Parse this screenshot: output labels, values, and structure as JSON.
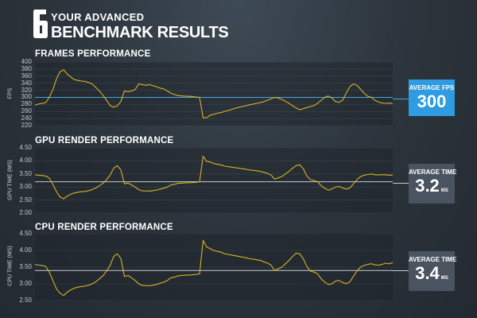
{
  "header": {
    "logo_icon": "rainbow-six-logo-icon",
    "line1": "YOUR ADVANCED",
    "line2": "BENCHMARK RESULTS"
  },
  "colors": {
    "fps_accent": "#2f9be0",
    "ms_box": "#4a5460",
    "series_line": "#d6b424",
    "fps_average_line": "#4aa8d8",
    "time_average_line": "#c8ccd0"
  },
  "panels": {
    "frames": {
      "title": "FRAMES PERFORMANCE",
      "axis_label": "FPS",
      "ticks": [
        "400",
        "380",
        "360",
        "340",
        "320",
        "300",
        "280",
        "260",
        "240",
        "220"
      ],
      "box_label": "AVERAGE FPS",
      "box_value": "300",
      "box_unit": ""
    },
    "gpu": {
      "title": "GPU RENDER PERFORMANCE",
      "axis_label": "GPU TIME (MS)",
      "ticks": [
        "4.50",
        "4.00",
        "3.50",
        "3.00",
        "2.50",
        "2.00"
      ],
      "box_label": "AVERAGE TIME",
      "box_value": "3.2",
      "box_unit": "MS"
    },
    "cpu": {
      "title": "CPU RENDER PERFORMANCE",
      "axis_label": "CPU TIME (MS)",
      "ticks": [
        "4.50",
        "4.00",
        "3.50",
        "3.00",
        "2.50"
      ],
      "box_label": "AVERAGE TIME",
      "box_value": "3.4",
      "box_unit": "MS"
    }
  },
  "chart_data": [
    {
      "type": "line",
      "title": "FRAMES PERFORMANCE",
      "ylabel": "FPS",
      "ylim": [
        220,
        400
      ],
      "grid": true,
      "average": 300,
      "x": [
        0,
        1,
        2,
        3,
        4,
        5,
        6,
        7,
        8,
        9,
        10,
        11,
        12,
        13,
        14,
        15,
        16,
        17,
        18,
        19,
        20,
        21,
        22,
        23,
        24,
        25,
        26,
        27,
        28,
        29,
        30,
        31,
        32,
        33,
        34,
        35,
        36,
        37,
        38,
        39,
        40,
        41,
        42,
        43,
        44,
        45,
        46,
        47,
        48,
        49,
        50,
        51,
        52,
        53,
        54,
        55,
        56,
        57,
        58,
        59,
        60,
        61,
        62,
        63,
        64,
        65,
        66,
        67,
        68,
        69,
        70,
        71,
        72,
        73,
        74,
        75,
        76,
        77,
        78,
        79,
        80,
        81,
        82,
        83,
        84,
        85,
        86,
        87,
        88,
        89,
        90,
        91,
        92,
        93,
        94,
        95,
        96,
        97,
        98,
        99,
        100
      ],
      "values": [
        278,
        281,
        283,
        285,
        300,
        322,
        352,
        372,
        378,
        366,
        358,
        350,
        348,
        346,
        345,
        342,
        338,
        328,
        318,
        306,
        292,
        277,
        272,
        276,
        288,
        318,
        316,
        318,
        322,
        338,
        336,
        334,
        336,
        333,
        330,
        326,
        324,
        318,
        312,
        308,
        305,
        304,
        303,
        303,
        302,
        301,
        300,
        242,
        242,
        250,
        252,
        255,
        257,
        260,
        263,
        266,
        269,
        272,
        274,
        276,
        279,
        281,
        283,
        285,
        288,
        292,
        296,
        300,
        298,
        294,
        289,
        283,
        276,
        270,
        265,
        268,
        271,
        274,
        277,
        283,
        292,
        300,
        304,
        298,
        288,
        286,
        292,
        312,
        330,
        338,
        334,
        323,
        312,
        303,
        300,
        292,
        287,
        284,
        283,
        284,
        282
      ]
    },
    {
      "type": "line",
      "title": "GPU RENDER PERFORMANCE",
      "ylabel": "GPU TIME (MS)",
      "ylim": [
        2.0,
        4.5
      ],
      "grid": true,
      "average": 3.2,
      "x": [
        0,
        1,
        2,
        3,
        4,
        5,
        6,
        7,
        8,
        9,
        10,
        11,
        12,
        13,
        14,
        15,
        16,
        17,
        18,
        19,
        20,
        21,
        22,
        23,
        24,
        25,
        26,
        27,
        28,
        29,
        30,
        31,
        32,
        33,
        34,
        35,
        36,
        37,
        38,
        39,
        40,
        41,
        42,
        43,
        44,
        45,
        46,
        47,
        48,
        49,
        50,
        51,
        52,
        53,
        54,
        55,
        56,
        57,
        58,
        59,
        60,
        61,
        62,
        63,
        64,
        65,
        66,
        67,
        68,
        69,
        70,
        71,
        72,
        73,
        74,
        75,
        76,
        77,
        78,
        79,
        80,
        81,
        82,
        83,
        84,
        85,
        86,
        87,
        88,
        89,
        90,
        91,
        92,
        93,
        94,
        95,
        96,
        97,
        98,
        99,
        100
      ],
      "values": [
        3.47,
        3.45,
        3.44,
        3.42,
        3.34,
        3.1,
        2.82,
        2.62,
        2.55,
        2.65,
        2.72,
        2.77,
        2.8,
        2.82,
        2.83,
        2.86,
        2.9,
        2.96,
        3.05,
        3.14,
        3.28,
        3.45,
        3.72,
        3.82,
        3.66,
        3.12,
        3.15,
        3.08,
        3.0,
        2.9,
        2.85,
        2.85,
        2.84,
        2.86,
        2.88,
        2.92,
        2.95,
        3.0,
        3.08,
        3.1,
        3.14,
        3.15,
        3.16,
        3.16,
        3.17,
        3.18,
        3.2,
        4.18,
        3.98,
        3.96,
        3.9,
        3.87,
        3.85,
        3.8,
        3.78,
        3.76,
        3.74,
        3.72,
        3.7,
        3.68,
        3.65,
        3.64,
        3.62,
        3.6,
        3.56,
        3.52,
        3.46,
        3.3,
        3.35,
        3.4,
        3.5,
        3.6,
        3.72,
        3.82,
        3.85,
        3.7,
        3.42,
        3.28,
        3.25,
        3.2,
        3.05,
        2.95,
        2.88,
        2.92,
        3.0,
        3.02,
        2.96,
        2.92,
        2.96,
        3.12,
        3.28,
        3.4,
        3.45,
        3.48,
        3.5,
        3.47,
        3.46,
        3.47,
        3.47,
        3.45,
        3.46
      ]
    },
    {
      "type": "line",
      "title": "CPU RENDER PERFORMANCE",
      "ylabel": "CPU TIME (MS)",
      "ylim": [
        2.5,
        4.5
      ],
      "grid": true,
      "average": 3.4,
      "x": [
        0,
        1,
        2,
        3,
        4,
        5,
        6,
        7,
        8,
        9,
        10,
        11,
        12,
        13,
        14,
        15,
        16,
        17,
        18,
        19,
        20,
        21,
        22,
        23,
        24,
        25,
        26,
        27,
        28,
        29,
        30,
        31,
        32,
        33,
        34,
        35,
        36,
        37,
        38,
        39,
        40,
        41,
        42,
        43,
        44,
        45,
        46,
        47,
        48,
        49,
        50,
        51,
        52,
        53,
        54,
        55,
        56,
        57,
        58,
        59,
        60,
        61,
        62,
        63,
        64,
        65,
        66,
        67,
        68,
        69,
        70,
        71,
        72,
        73,
        74,
        75,
        76,
        77,
        78,
        79,
        80,
        81,
        82,
        83,
        84,
        85,
        86,
        87,
        88,
        89,
        90,
        91,
        92,
        93,
        94,
        95,
        96,
        97,
        98,
        99,
        100
      ],
      "values": [
        3.58,
        3.56,
        3.55,
        3.52,
        3.35,
        3.1,
        2.85,
        2.72,
        2.65,
        2.75,
        2.82,
        2.87,
        2.9,
        2.92,
        2.93,
        2.96,
        3.0,
        3.06,
        3.15,
        3.24,
        3.38,
        3.55,
        3.82,
        3.9,
        3.76,
        3.22,
        3.25,
        3.18,
        3.1,
        3.0,
        2.95,
        2.95,
        2.94,
        2.96,
        2.98,
        3.02,
        3.05,
        3.1,
        3.18,
        3.2,
        3.24,
        3.25,
        3.26,
        3.26,
        3.27,
        3.28,
        3.3,
        4.3,
        4.1,
        4.05,
        4.0,
        3.97,
        3.95,
        3.9,
        3.88,
        3.86,
        3.84,
        3.82,
        3.8,
        3.78,
        3.75,
        3.74,
        3.72,
        3.7,
        3.66,
        3.62,
        3.56,
        3.4,
        3.45,
        3.5,
        3.6,
        3.7,
        3.82,
        3.92,
        3.9,
        3.75,
        3.52,
        3.38,
        3.35,
        3.3,
        3.15,
        3.05,
        2.98,
        3.0,
        3.08,
        3.1,
        3.04,
        3.0,
        3.06,
        3.22,
        3.38,
        3.5,
        3.55,
        3.58,
        3.6,
        3.57,
        3.56,
        3.58,
        3.62,
        3.6,
        3.64
      ]
    }
  ]
}
